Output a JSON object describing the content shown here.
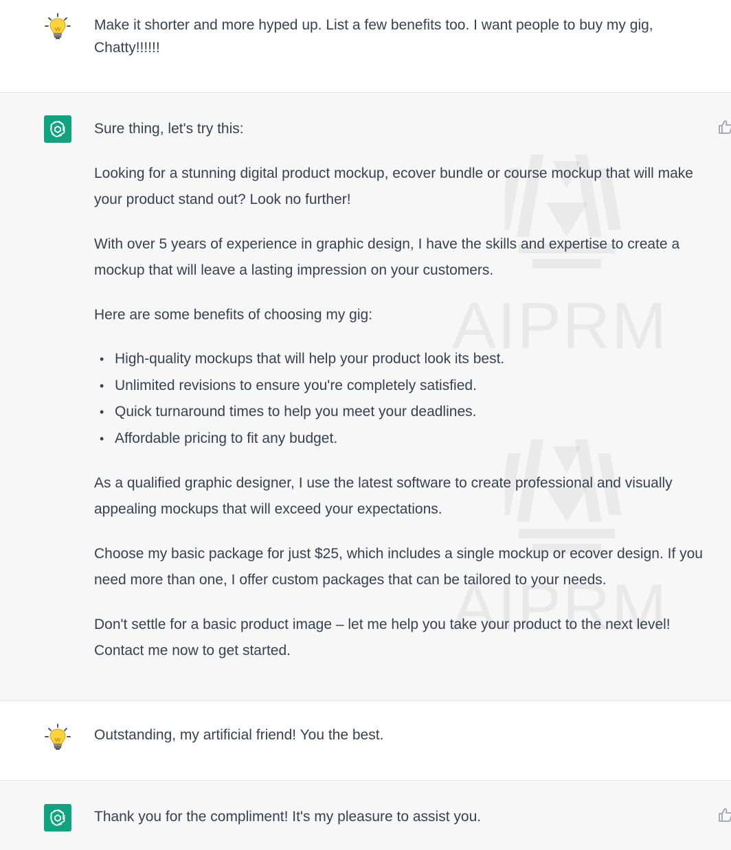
{
  "conversation": {
    "messages": [
      {
        "role": "user",
        "avatar_icon": "lightbulb-icon",
        "text": "Make it shorter and more hyped up. List a few benefits too. I want people to buy my gig, Chatty!!!!!!"
      },
      {
        "role": "assistant",
        "avatar_icon": "chatgpt-logo-icon",
        "intro": "Sure thing, let's try this:",
        "paragraphs_before": [
          "Looking for a stunning digital product mockup, ecover bundle or course mockup that will make your product stand out? Look no further!",
          "With over 5 years of experience in graphic design, I have the skills and expertise to create a mockup that will leave a lasting impression on your customers.",
          "Here are some benefits of choosing my gig:"
        ],
        "benefits": [
          "High-quality mockups that will help your product look its best.",
          "Unlimited revisions to ensure you're completely satisfied.",
          "Quick turnaround times to help you meet your deadlines.",
          "Affordable pricing to fit any budget."
        ],
        "paragraphs_after": [
          "As a qualified graphic designer, I use the latest software to create professional and visually appealing mockups that will exceed your expectations.",
          "Choose my basic package for just $25, which includes a single mockup or ecover design. If you need more than one, I offer custom packages that can be tailored to your needs.",
          "Don't settle for a basic product image – let me help you take your product to the next level! Contact me now to get started."
        ]
      },
      {
        "role": "user",
        "avatar_icon": "lightbulb-icon",
        "text": "Outstanding, my artificial friend! You the best."
      },
      {
        "role": "assistant",
        "avatar_icon": "chatgpt-logo-icon",
        "text": "Thank you for the compliment! It's my pleasure to assist you."
      }
    ]
  },
  "watermark": {
    "text_1": "AIPRM",
    "text_2": "AIPRM"
  },
  "colors": {
    "assistant_bg": "#f7f7f8",
    "user_bg": "#ffffff",
    "bot_avatar": "#10a37f",
    "text": "#374151"
  }
}
